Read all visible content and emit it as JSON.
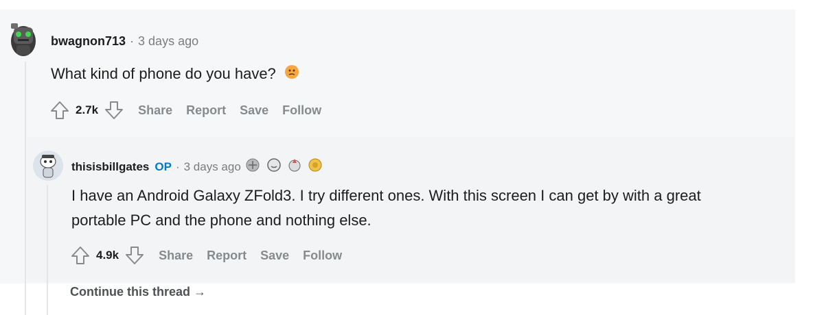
{
  "comments": [
    {
      "username": "bwagnon713",
      "time": "3 days ago",
      "body": "What kind of phone do you have?",
      "emoji_icon": "thinking-face-icon",
      "score": "2.7k",
      "actions": [
        "Share",
        "Report",
        "Save",
        "Follow"
      ]
    },
    {
      "username": "thisisbillgates",
      "op_badge": "OP",
      "time": "3 days ago",
      "award_icons": [
        "helpful-award-icon",
        "wholesome-award-icon",
        "rocket-award-icon",
        "gold-award-icon"
      ],
      "body_lines": [
        "I have an Android Galaxy ZFold3. I try different ones. With this screen I can get by with a great",
        "portable PC and the phone and nothing else."
      ],
      "score": "4.9k",
      "actions": [
        "Share",
        "Report",
        "Save",
        "Follow"
      ]
    }
  ],
  "continue_thread": "Continue this thread →",
  "separator": "·",
  "colors": {
    "background": "#f6f7f8",
    "op_blue": "#0079d3",
    "muted": "#878a8c",
    "thread_line": "#e3e5e7"
  }
}
